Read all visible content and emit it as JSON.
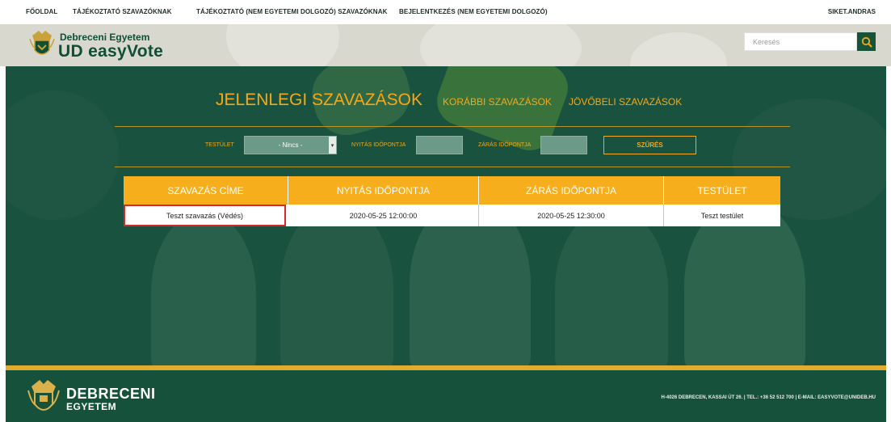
{
  "topnav": {
    "items": [
      "FŐOLDAL",
      "TÁJÉKOZTATÓ SZAVAZÓKNAK",
      "TÁJÉKOZTATÓ (NEM EGYETEMI DOLGOZÓ) SZAVAZÓKNAK",
      "BEJELENTKEZÉS (NEM EGYETEMI DOLGOZÓ)"
    ],
    "user": "SIKET.ANDRAS"
  },
  "header": {
    "brand_sub": "Debreceni Egyetem",
    "brand_main": "UD easyVote",
    "search_placeholder": "Keresés",
    "accent": "#0f4f36"
  },
  "tabs": {
    "current": "JELENLEGI SZAVAZÁSOK",
    "previous": "KORÁBBI SZAVAZÁSOK",
    "future": "JÖVŐBELI SZAVAZÁSOK"
  },
  "filters": {
    "body_label": "TESTÜLET",
    "body_selected": "- Nincs -",
    "open_label": "NYITÁS IDŐPONTJA",
    "close_label": "ZÁRÁS IDŐPONTJA",
    "submit": "SZŰRÉS"
  },
  "table": {
    "headers": [
      "SZAVAZÁS CÍME",
      "NYITÁS IDŐPONTJA",
      "ZÁRÁS IDŐPONTJA",
      "TESTÜLET"
    ],
    "rows": [
      [
        "Teszt szavazás (Védés)",
        "2020-05-25 12:00:00",
        "2020-05-25 12:30:00",
        "Teszt testület"
      ]
    ]
  },
  "footer": {
    "name1": "DEBRECENI",
    "name2": "EGYETEM",
    "contact": "H-4026 DEBRECEN, KASSAI ÚT 26. | TEL.: +36 52 512 700 | E-MAIL: EASYVOTE@UNIDEB.HU"
  },
  "colors": {
    "gold": "#f3a81a",
    "green_dark": "#16513b",
    "highlight": "#d9272e"
  },
  "icons": {
    "search": "search-icon",
    "logo": "university-crest-icon"
  }
}
